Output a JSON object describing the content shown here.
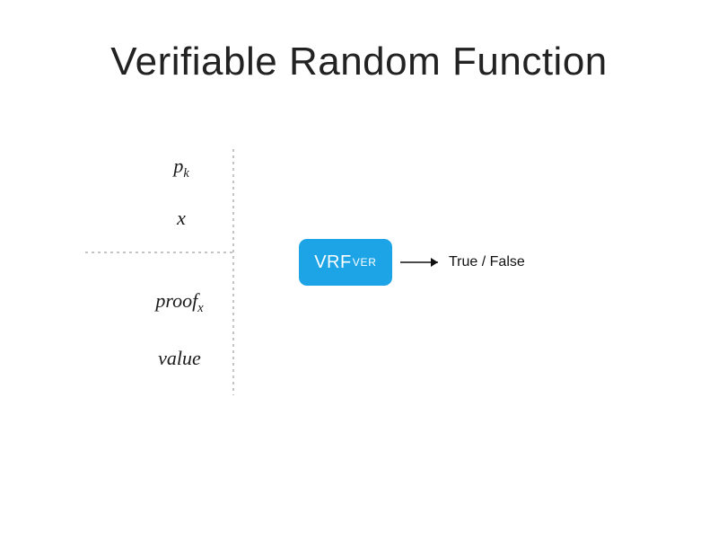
{
  "title": "Verifiable Random Function",
  "inputs": {
    "pk_base": "p",
    "pk_sub": "k",
    "x": "x",
    "proof_base": "proof",
    "proof_sub": "x",
    "value": "value"
  },
  "box": {
    "main": "VRF",
    "sub": "VER",
    "color": "#1DA4E6"
  },
  "output": "True / False"
}
